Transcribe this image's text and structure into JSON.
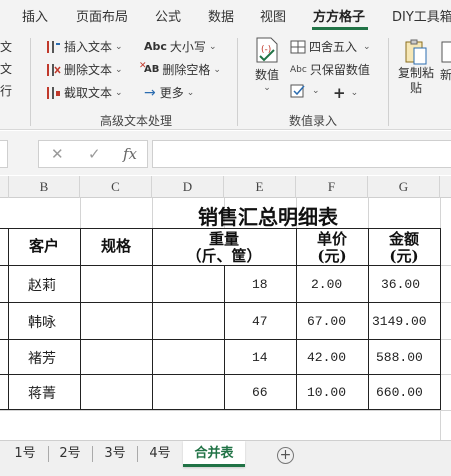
{
  "menu": {
    "items": [
      "插入",
      "页面布局",
      "公式",
      "数据",
      "视图",
      "方方格子",
      "DIY工具箱"
    ],
    "active": "方方格子"
  },
  "ribbon": {
    "left_partial": [
      "文",
      "文",
      "行"
    ],
    "text_group": {
      "insert_text": "插入文本",
      "delete_text": "删除文本",
      "extract_text": "截取文本",
      "case": "大小写",
      "delete_spaces": "删除空格",
      "more": "更多",
      "label": "高级文本处理"
    },
    "number_group": {
      "numeric": "数值",
      "round": "四舍五入",
      "keep_numbers": "只保留数值",
      "label": "数值录入"
    },
    "paste_group": {
      "copy_paste": "复制粘贴",
      "new": "新"
    },
    "icons": {
      "abc_small": "Abc",
      "ab_cross": "AB",
      "arrow": "→"
    }
  },
  "formula_bar": {
    "cancel": "✕",
    "confirm": "✓",
    "fx": "fx",
    "value": ""
  },
  "columns": [
    "B",
    "C",
    "D",
    "E",
    "F",
    "G"
  ],
  "sheet": {
    "title": "销售汇总明细表",
    "headers": {
      "customer": "客户",
      "spec": "规格",
      "weight_line1": "重量",
      "weight_line2": "（斤、筐）",
      "price_line1": "单价",
      "price_line2": "(元)",
      "amount_line1": "金额",
      "amount_line2": "(元)"
    },
    "rows": [
      {
        "customer": "赵莉",
        "spec": "",
        "weight": "18",
        "price": "2.00",
        "amount": "36.00"
      },
      {
        "customer": "韩咏",
        "spec": "",
        "weight": "47",
        "price": "67.00",
        "amount": "3149.00"
      },
      {
        "customer": "褚芳",
        "spec": "",
        "weight": "14",
        "price": "42.00",
        "amount": "588.00"
      },
      {
        "customer": "蒋菁",
        "spec": "",
        "weight": "66",
        "price": "10.00",
        "amount": "660.00"
      }
    ]
  },
  "tabs": {
    "items": [
      "1号",
      "2号",
      "3号",
      "4号",
      "合并表"
    ],
    "active": "合并表",
    "add": "+"
  },
  "colors": {
    "accent": "#217346",
    "ribbon_bg": "#f3f3f3",
    "icon_red": "#c0392b",
    "icon_blue": "#2b6cb0"
  }
}
